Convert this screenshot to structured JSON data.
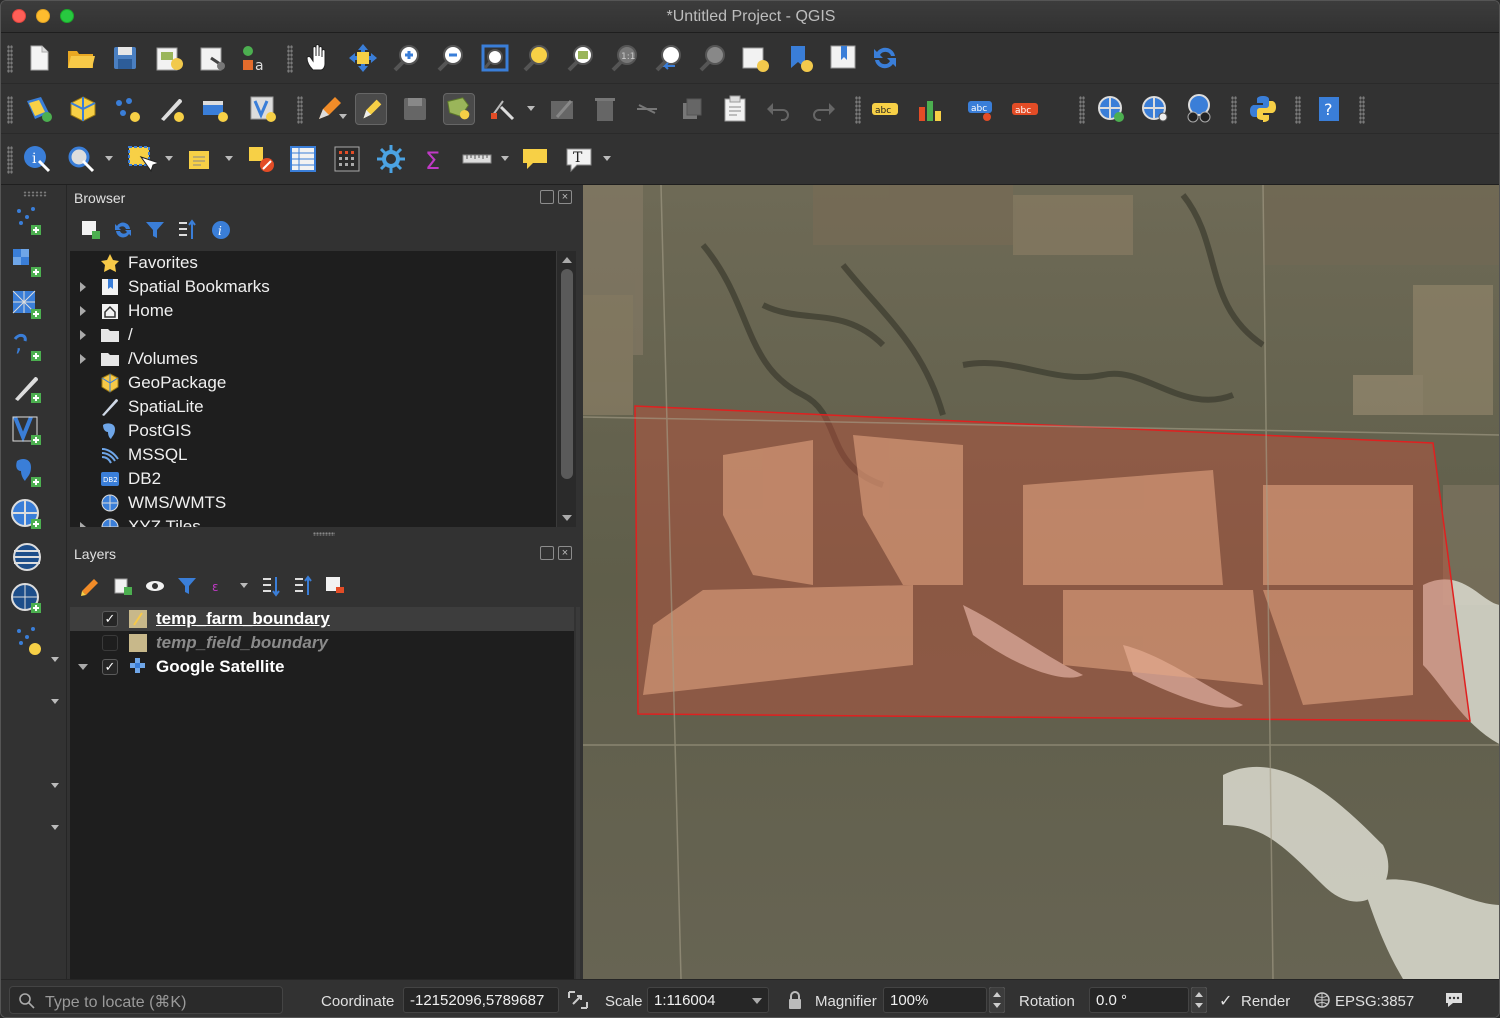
{
  "window": {
    "title": "*Untitled Project - QGIS"
  },
  "toolbar1": [
    {
      "name": "new-project-icon"
    },
    {
      "name": "open-project-icon"
    },
    {
      "name": "save-project-icon"
    },
    {
      "name": "new-print-layout-icon"
    },
    {
      "name": "layout-manager-icon"
    },
    {
      "name": "style-manager-icon"
    },
    {
      "name": "pan-icon"
    },
    {
      "name": "pan-to-selection-icon"
    },
    {
      "name": "zoom-in-icon"
    },
    {
      "name": "zoom-out-icon"
    },
    {
      "name": "zoom-full-icon"
    },
    {
      "name": "zoom-to-selection-icon"
    },
    {
      "name": "zoom-to-layer-icon"
    },
    {
      "name": "zoom-native-icon"
    },
    {
      "name": "zoom-last-icon"
    },
    {
      "name": "zoom-next-icon"
    },
    {
      "name": "new-map-view-icon"
    },
    {
      "name": "new-bookmark-icon"
    },
    {
      "name": "show-bookmarks-icon"
    },
    {
      "name": "refresh-icon"
    }
  ],
  "browser": {
    "title": "Browser",
    "items": [
      {
        "label": "Favorites",
        "expandable": false,
        "icon": "star-icon"
      },
      {
        "label": "Spatial Bookmarks",
        "expandable": true,
        "icon": "bookmark-icon"
      },
      {
        "label": "Home",
        "expandable": true,
        "icon": "home-icon"
      },
      {
        "label": "/",
        "expandable": true,
        "icon": "folder-icon"
      },
      {
        "label": "/Volumes",
        "expandable": true,
        "icon": "folder-icon"
      },
      {
        "label": "GeoPackage",
        "expandable": false,
        "icon": "geopackage-icon"
      },
      {
        "label": "SpatiaLite",
        "expandable": false,
        "icon": "spatialite-icon"
      },
      {
        "label": "PostGIS",
        "expandable": false,
        "icon": "postgis-icon"
      },
      {
        "label": "MSSQL",
        "expandable": false,
        "icon": "mssql-icon"
      },
      {
        "label": "DB2",
        "expandable": false,
        "icon": "db2-icon"
      },
      {
        "label": "WMS/WMTS",
        "expandable": false,
        "icon": "wms-icon"
      },
      {
        "label": "XYZ Tiles",
        "expandable": true,
        "icon": "xyz-icon"
      }
    ]
  },
  "layers": {
    "title": "Layers",
    "items": [
      {
        "label": "temp_farm_boundary",
        "checked": true,
        "selected": true,
        "color": "#c8b88a"
      },
      {
        "label": "temp_field_boundary",
        "checked": false,
        "selected": false,
        "color": "#c8b88a"
      },
      {
        "label": "Google Satellite",
        "checked": true,
        "selected": false,
        "color": "#ffffff"
      }
    ]
  },
  "statusbar": {
    "locator_placeholder": "Type to locate (⌘K)",
    "coordinate_label": "Coordinate",
    "coordinate_value": "-12152096,5789687",
    "scale_label": "Scale",
    "scale_value": "1:116004",
    "magnifier_label": "Magnifier",
    "magnifier_value": "100%",
    "rotation_label": "Rotation",
    "rotation_value": "0.0 °",
    "render_label": "Render",
    "render_checked": true,
    "crs_value": "EPSG:3857"
  },
  "colors": {
    "accent": "#3874d8",
    "polygon_stroke": "#e02020",
    "polygon_fill": "#c8523c"
  }
}
